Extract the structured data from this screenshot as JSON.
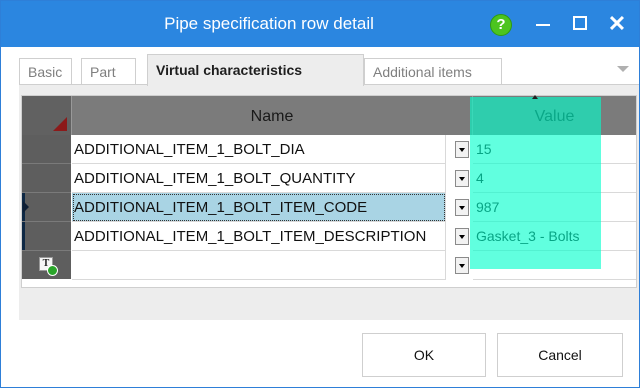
{
  "window": {
    "title": "Pipe specification row detail",
    "help_label": "?",
    "close_label": "✕"
  },
  "tabs": [
    {
      "label": "Basic",
      "active": false
    },
    {
      "label": "Part",
      "active": false
    },
    {
      "label": "Virtual characteristics",
      "active": true
    },
    {
      "label": "Additional items",
      "active": false
    }
  ],
  "grid": {
    "columns": [
      "Name",
      "Value"
    ],
    "rows": [
      {
        "name": "ADDITIONAL_ITEM_1_BOLT_DIA",
        "value": "15"
      },
      {
        "name": "ADDITIONAL_ITEM_1_BOLT_QUANTITY",
        "value": "4"
      },
      {
        "name": "ADDITIONAL_ITEM_1_BOLT_ITEM_CODE",
        "value": "987",
        "selected": true
      },
      {
        "name": "ADDITIONAL_ITEM_1_BOLT_ITEM_DESCRIPTION",
        "value": "Gasket_3 - Bolts"
      }
    ],
    "new_row_icon": "T"
  },
  "buttons": {
    "ok": "OK",
    "cancel": "Cancel"
  },
  "colors": {
    "titlebar": "#2b86e0",
    "highlight": "#00ffcc",
    "selected_row": "#a9d4e4"
  }
}
